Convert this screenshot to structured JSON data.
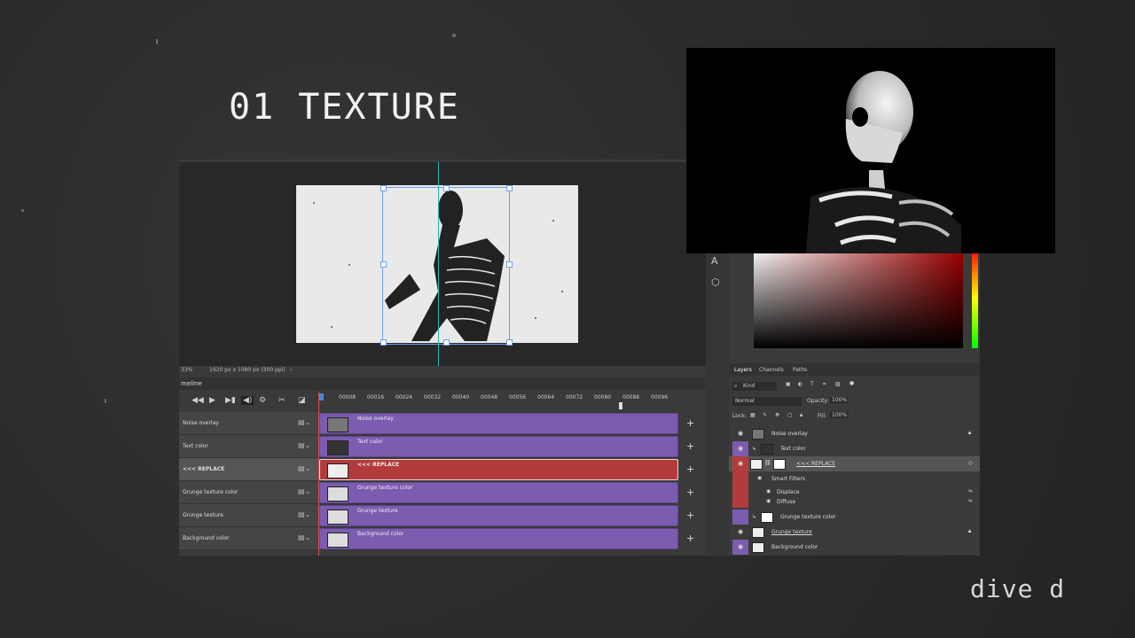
{
  "slide": {
    "title": "01 TEXTURE",
    "brand": "dive d"
  },
  "canvas": {
    "zoom": "33%",
    "dimensions": "1920 px x 1080 px (300 ppi)"
  },
  "timeline": {
    "panel_label": "meline",
    "ruler_ticks": [
      "00008",
      "00016",
      "00024",
      "00032",
      "00040",
      "00048",
      "00056",
      "00064",
      "00072",
      "00080",
      "00088",
      "00096"
    ],
    "tracks": [
      {
        "name": "Noise overlay",
        "clip": "Noise overlay",
        "color": "#7b5cb0"
      },
      {
        "name": "Text color",
        "clip": "Text color",
        "color": "#7b5cb0"
      },
      {
        "name": "<<< REPLACE",
        "clip": "<<< REPLACE",
        "color": "#b23b3b"
      },
      {
        "name": "Grunge texture color",
        "clip": "Grunge texture color",
        "color": "#7b5cb0"
      },
      {
        "name": "Grunge texture",
        "clip": "Grunge texture",
        "color": "#7b5cb0"
      },
      {
        "name": "Background color",
        "clip": "Background color",
        "color": "#7b5cb0"
      }
    ],
    "add_symbol": "+"
  },
  "layers_panel": {
    "tabs": [
      "Layers",
      "Channels",
      "Paths"
    ],
    "filter_kind": "Kind",
    "blend_mode": "Normal",
    "opacity_label": "Opacity:",
    "opacity": "100%",
    "lock_label": "Lock:",
    "fill_label": "Fill:",
    "fill": "100%",
    "layers": [
      {
        "name": "Noise overlay"
      },
      {
        "name": "Text color"
      },
      {
        "name": "<<< REPLACE"
      },
      {
        "name": "Smart Filters"
      },
      {
        "name": "Displace"
      },
      {
        "name": "Diffuse"
      },
      {
        "name": "Grunge texture color"
      },
      {
        "name": "Grunge texture"
      },
      {
        "name": "Background color"
      }
    ]
  }
}
